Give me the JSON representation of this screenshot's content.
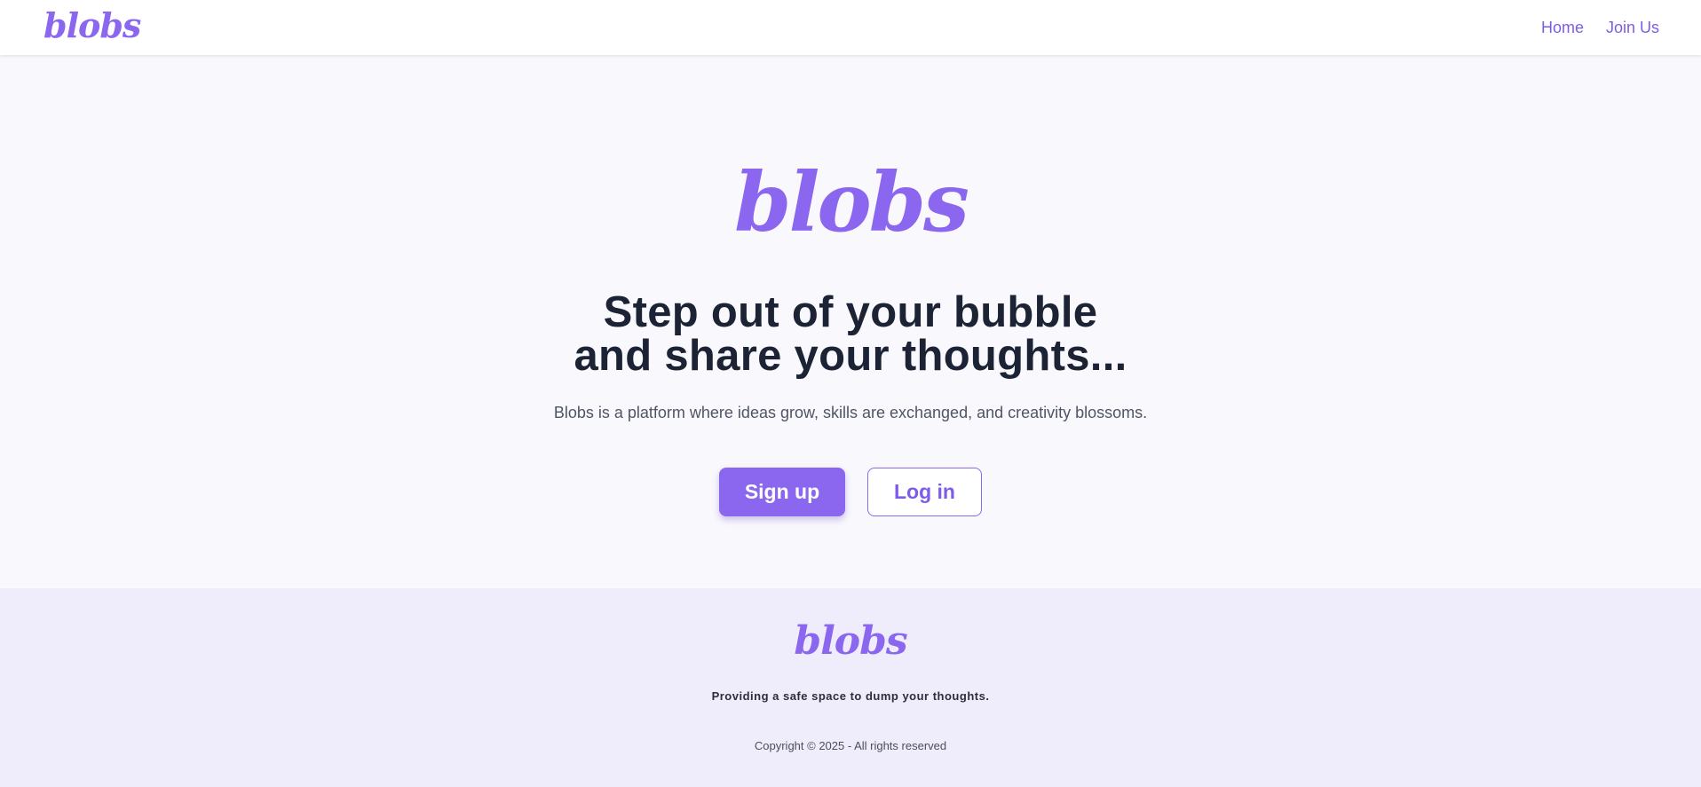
{
  "brand": {
    "name": "blobs",
    "color": "#8b67f0"
  },
  "nav": {
    "links": [
      {
        "label": "Home"
      },
      {
        "label": "Join Us"
      }
    ]
  },
  "hero": {
    "headline_line1": "Step out of your bubble",
    "headline_line2": "and share your thoughts...",
    "subtitle": "Blobs is a platform where ideas grow, skills are exchanged, and creativity blossoms.",
    "primary_button": "Sign up",
    "secondary_button": "Log in"
  },
  "footer": {
    "tagline": "Providing a safe space to dump your thoughts.",
    "copyright": "Copyright © 2025 - All rights reserved"
  }
}
